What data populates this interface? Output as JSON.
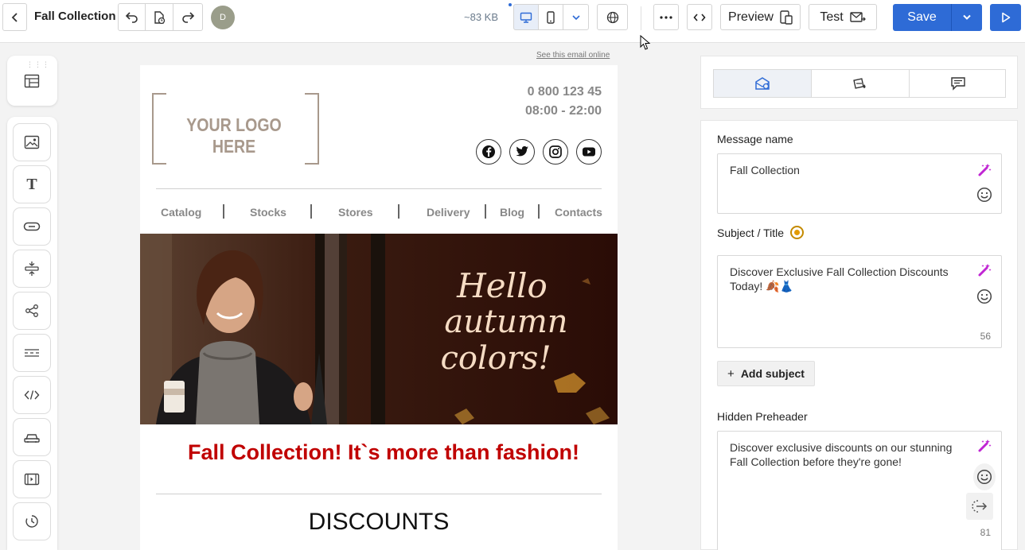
{
  "header": {
    "title": "Fall Collection",
    "avatar_initial": "D",
    "size": "~83 KB",
    "preview_label": "Preview",
    "test_label": "Test",
    "save_label": "Save"
  },
  "email": {
    "see_online": "See this email online",
    "logo_text": "YOUR LOGO HERE",
    "phone": "0 800 123 45",
    "hours": "08:00 - 22:00",
    "menu": [
      "Catalog",
      "Stocks",
      "Stores",
      "Delivery",
      "Blog",
      "Contacts"
    ],
    "hero_text": [
      "Hello",
      "autumn",
      "colors!"
    ],
    "headline": "Fall Collection! It`s more than fashion!",
    "section_title": "DISCOUNTS"
  },
  "settings": {
    "message_name_label": "Message name",
    "message_name_value": "Fall Collection",
    "subject_label": "Subject / Title",
    "subject_value": "Discover Exclusive Fall Collection Discounts Today! 🍂👗",
    "subject_count": "56",
    "add_subject_label": "Add subject",
    "preheader_label": "Hidden Preheader",
    "preheader_value": "Discover exclusive discounts on our stunning Fall Collection before they're gone!",
    "preheader_count": "81"
  },
  "colors": {
    "accent": "#2e6bd6",
    "headline": "#c00000",
    "magic": "#c026d3"
  }
}
